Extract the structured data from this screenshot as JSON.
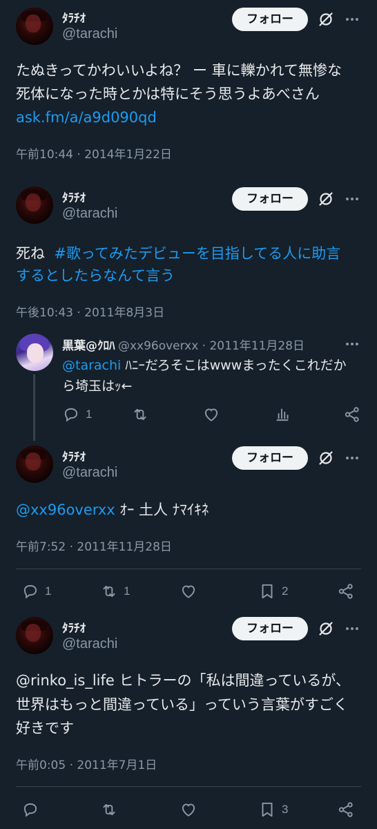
{
  "follow_label": "フォロー",
  "posts": [
    {
      "name": "ﾀﾗﾁｵ",
      "handle": "@tarachi",
      "line1": "たぬきってかわいいよね？ ー 車に轢かれて無惨な",
      "line2": "死体になった時とかは特にそう思うよあべさん",
      "link": "ask.fm/a/a9d090qd",
      "timestamp": "午前10:44 · 2014年1月22日"
    },
    {
      "name": "ﾀﾗﾁｵ",
      "handle": "@tarachi",
      "prefix": "死ね",
      "hashtag_line1": "#歌ってみたデビューを目指してる人に助言",
      "hashtag_line2": "するとしたらなんて言う",
      "timestamp": "午後10:43 · 2011年8月3日"
    },
    {
      "name": "黒葉@ｸﾛﾊ",
      "handle_time": "@xx96overxx · 2011年11月28日",
      "mention": "@tarachi",
      "text_line1": " ﾊﾆｰだろそこはwwwまったくこれだか",
      "text_line2": "ら埼玉はｯ←",
      "replies": "1"
    },
    {
      "name": "ﾀﾗﾁｵ",
      "handle": "@tarachi",
      "mention": "@xx96overxx",
      "text": " ｵｰ 土人 ﾅﾏｲｷﾈ",
      "timestamp": "午前7:52 · 2011年11月28日",
      "replies": "1",
      "retweets": "1",
      "bookmarks": "2"
    },
    {
      "name": "ﾀﾗﾁｵ",
      "handle": "@tarachi",
      "line1": "@rinko_is_life ヒトラーの「私は間違っているが、",
      "line2": "世界はもっと間違っている」っていう言葉がすごく",
      "line3": "好きです",
      "timestamp": "午前0:05 · 2011年7月1日",
      "bookmarks": "3"
    }
  ],
  "colors": {
    "background": "#15202b",
    "text": "#e7e9ea",
    "secondary": "#8b98a5",
    "link": "#1d9bf0",
    "follow_bg": "#eff3f4"
  }
}
